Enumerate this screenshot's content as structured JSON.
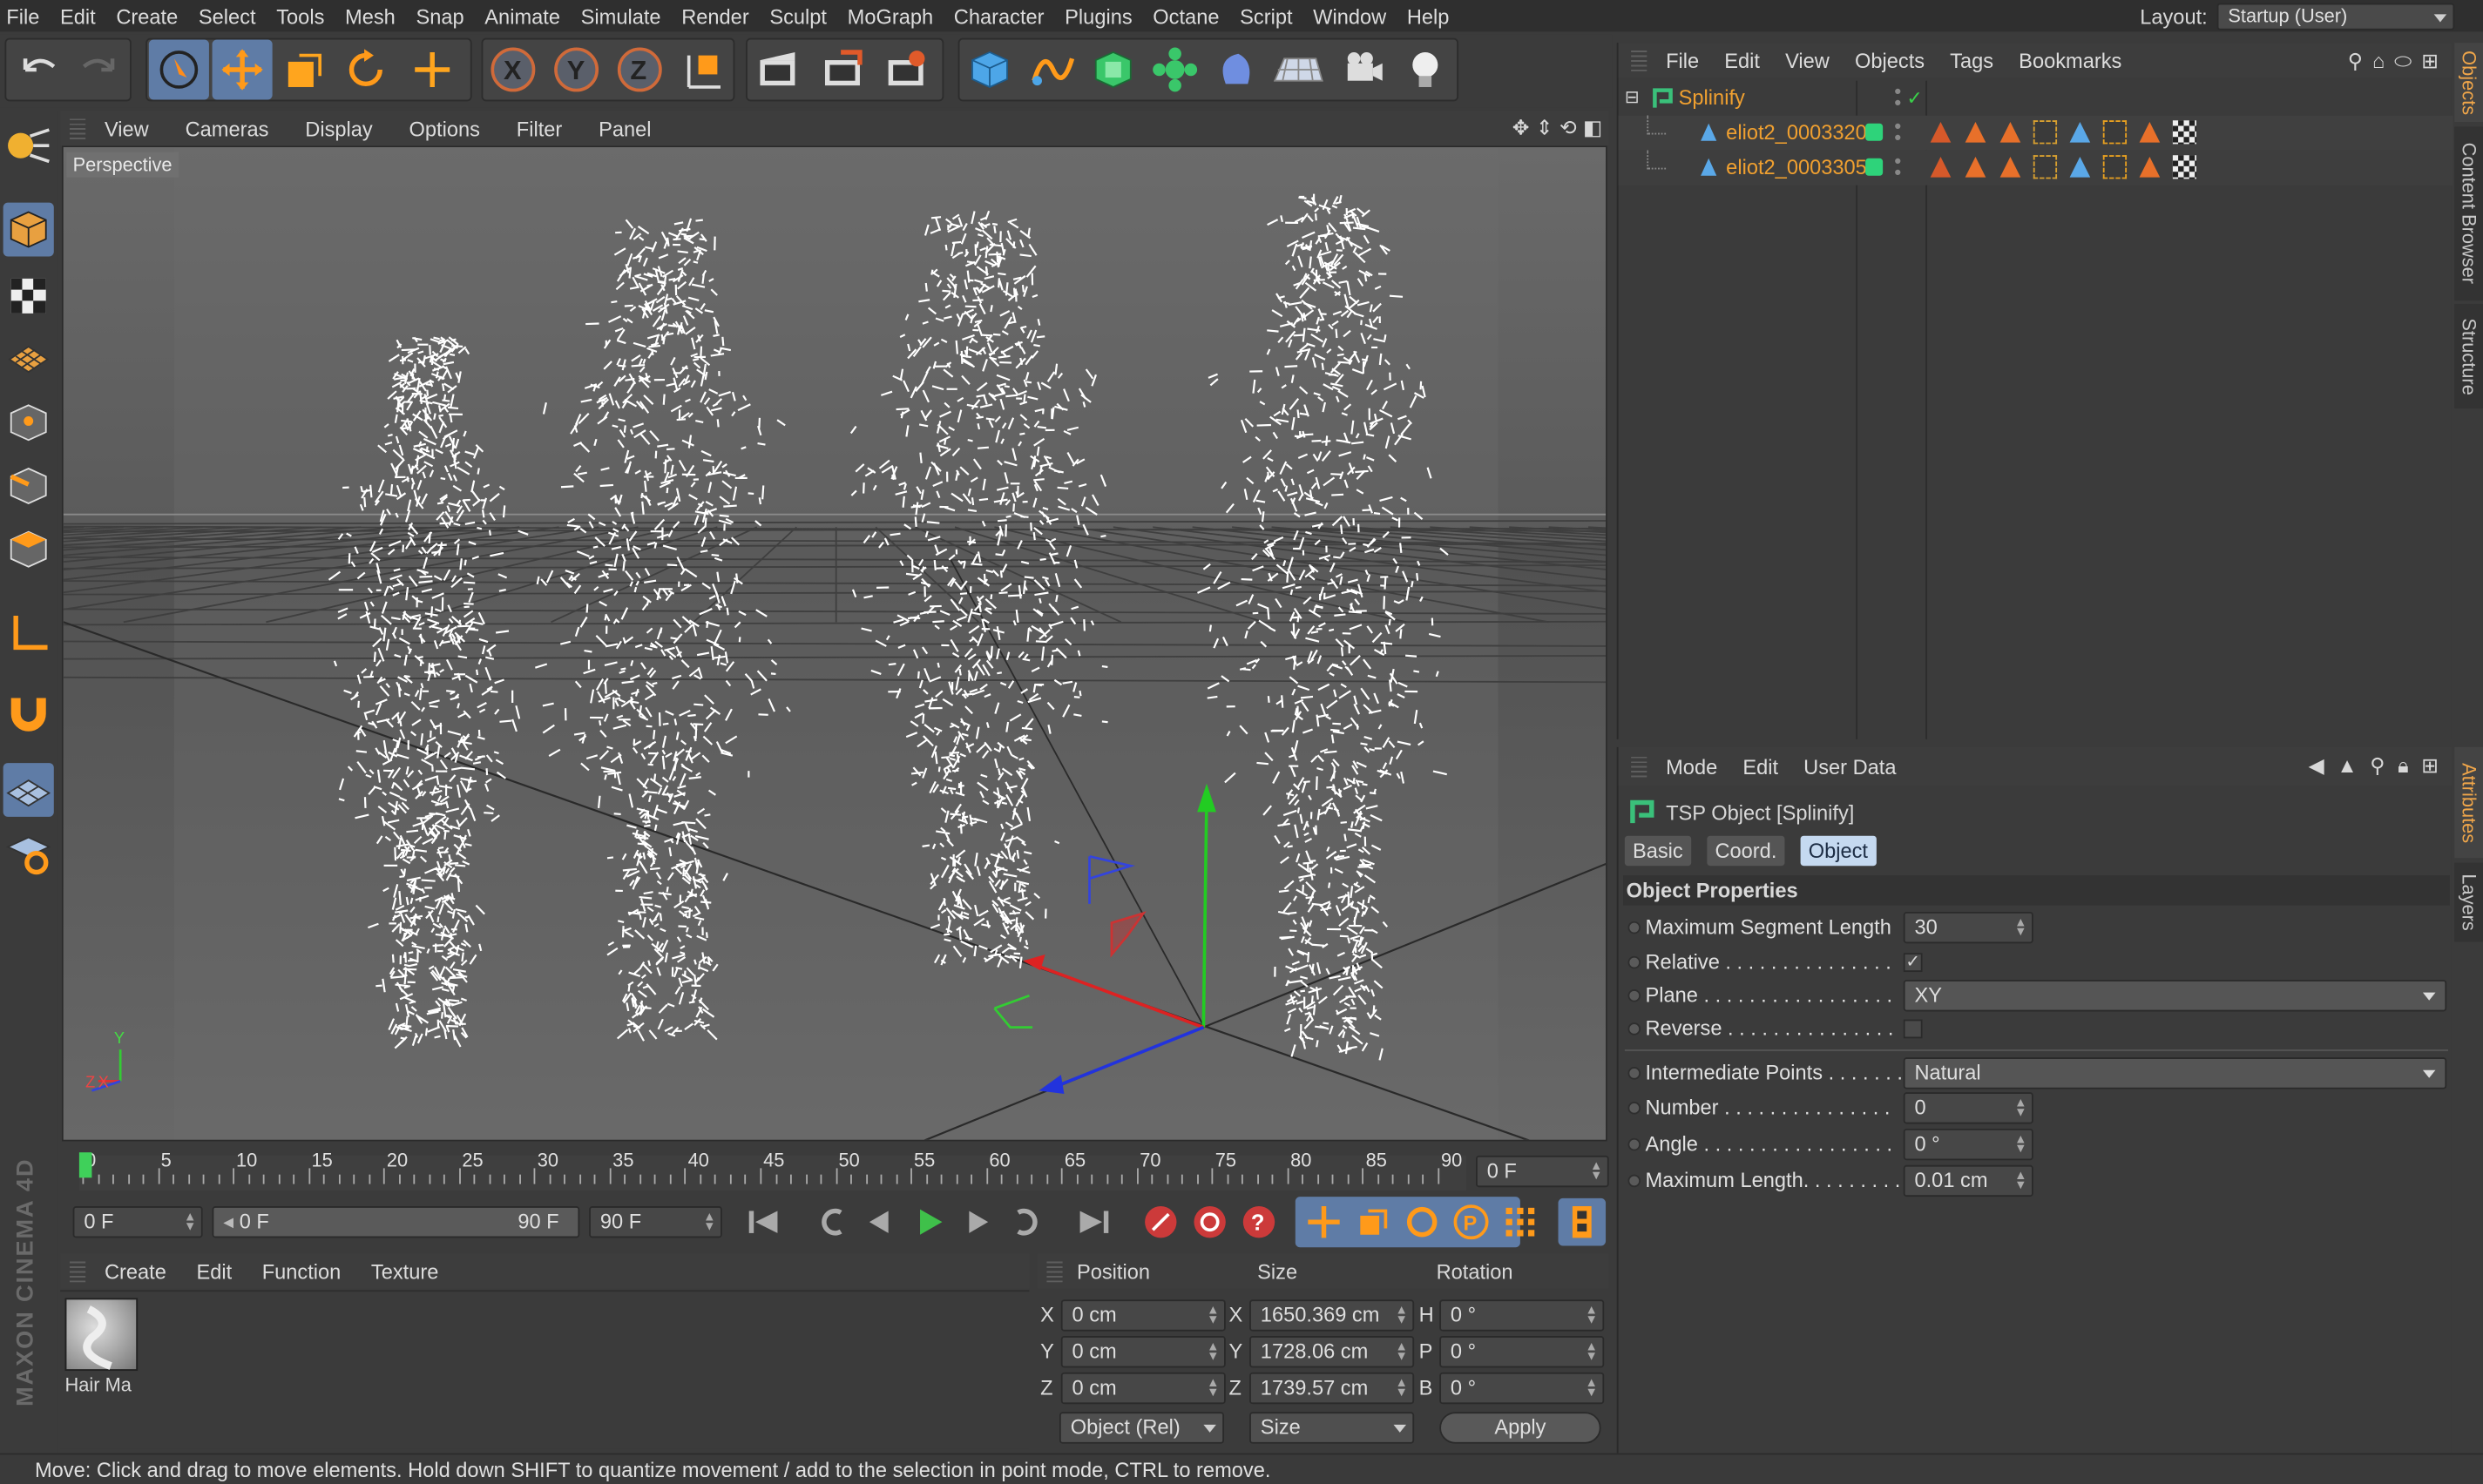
{
  "menubar": {
    "items": [
      "File",
      "Edit",
      "Create",
      "Select",
      "Tools",
      "Mesh",
      "Snap",
      "Animate",
      "Simulate",
      "Render",
      "Sculpt",
      "MoGraph",
      "Character",
      "Plugins",
      "Octane",
      "Script",
      "Window",
      "Help"
    ],
    "layout_label": "Layout:",
    "layout_value": "Startup (User)"
  },
  "viewport": {
    "menu": [
      "View",
      "Cameras",
      "Display",
      "Options",
      "Filter",
      "Panel"
    ],
    "camera_label": "Perspective",
    "axis": {
      "x": "X",
      "y": "Y",
      "z": "Z"
    }
  },
  "timeline": {
    "ticks": [
      "0",
      "5",
      "10",
      "15",
      "20",
      "25",
      "30",
      "35",
      "40",
      "45",
      "50",
      "55",
      "60",
      "65",
      "70",
      "75",
      "80",
      "85",
      "90"
    ],
    "current_frame": "0 F"
  },
  "transport": {
    "start": "0 F",
    "range_start": "0 F",
    "range_end": "90 F",
    "end": "90 F"
  },
  "materials": {
    "menu": [
      "Create",
      "Edit",
      "Function",
      "Texture"
    ],
    "items": [
      {
        "name": "Hair Ma"
      }
    ]
  },
  "coords": {
    "headers": {
      "position": "Position",
      "size": "Size",
      "rotation": "Rotation"
    },
    "rows": [
      {
        "axis": "X",
        "pos": "0 cm",
        "size_axis": "X",
        "size": "1650.369 cm",
        "rot_axis": "H",
        "rot": "0 °"
      },
      {
        "axis": "Y",
        "pos": "0 cm",
        "size_axis": "Y",
        "size": "1728.06 cm",
        "rot_axis": "P",
        "rot": "0 °"
      },
      {
        "axis": "Z",
        "pos": "0 cm",
        "size_axis": "Z",
        "size": "1739.57 cm",
        "rot_axis": "B",
        "rot": "0 °"
      }
    ],
    "mode": "Object (Rel)",
    "size_mode": "Size",
    "apply": "Apply"
  },
  "objects": {
    "menu": [
      "File",
      "Edit",
      "View",
      "Objects",
      "Tags",
      "Bookmarks"
    ],
    "tree": [
      {
        "name": "Splinify",
        "level": 0
      },
      {
        "name": "eliot2_0003320",
        "level": 1
      },
      {
        "name": "eliot2_0003305",
        "level": 1
      }
    ]
  },
  "right_tabs": {
    "top": [
      "Objects",
      "Content Browser",
      "Structure"
    ],
    "bottom": [
      "Attributes",
      "Layers"
    ]
  },
  "attributes": {
    "menu": [
      "Mode",
      "Edit",
      "User Data"
    ],
    "title": "TSP Object [Splinify]",
    "tabs": [
      "Basic",
      "Coord.",
      "Object"
    ],
    "active_tab": "Object",
    "section": "Object Properties",
    "props": [
      {
        "label": "Maximum Segment Length",
        "value": "30"
      },
      {
        "label": "Relative . . . . . . . . . . . . . . .",
        "value": "✓"
      },
      {
        "label": "Plane . . . . . . . . . . . . . . . . .",
        "value": "XY"
      },
      {
        "label": "Reverse . . . . . . . . . . . . . . .",
        "value": ""
      },
      {
        "label": "Intermediate Points . . . . . . .",
        "value": "Natural"
      },
      {
        "label": "Number . . . . . . . . . . . . . . .",
        "value": "0"
      },
      {
        "label": "Angle . . . . . . . . . . . . . . . . .",
        "value": "0 °"
      },
      {
        "label": "Maximum Length. . . . . . . . .",
        "value": "0.01 cm"
      }
    ]
  },
  "status": "Move: Click and drag to move elements. Hold down SHIFT to quantize movement / add to the selection in point mode, CTRL to remove.",
  "brand": "MAXON CINEMA 4D",
  "colors": {
    "accent": "#5f7ca6",
    "object_name": "#f0a030",
    "tab_active": "#c5d9f0",
    "play": "#3fc04a"
  }
}
